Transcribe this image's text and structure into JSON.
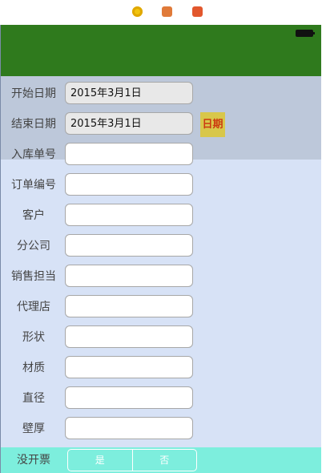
{
  "toolbar": {
    "icons": [
      "target-icon",
      "cube-icon",
      "exit-icon"
    ]
  },
  "form": {
    "start_label": "开始日期",
    "start_value": "2015年3月1日",
    "end_label": "结束日期",
    "end_value": "2015年3月1日",
    "date_button": "日期",
    "fields": [
      {
        "label": "入库单号"
      },
      {
        "label": "订单编号"
      },
      {
        "label": "客户"
      },
      {
        "label": "分公司"
      },
      {
        "label": "销售担当"
      },
      {
        "label": "代理店"
      },
      {
        "label": "形状"
      },
      {
        "label": "材质"
      },
      {
        "label": "直径"
      },
      {
        "label": "壁厚"
      }
    ],
    "invoice_label": "没开票",
    "segment": [
      "是",
      "否"
    ]
  }
}
